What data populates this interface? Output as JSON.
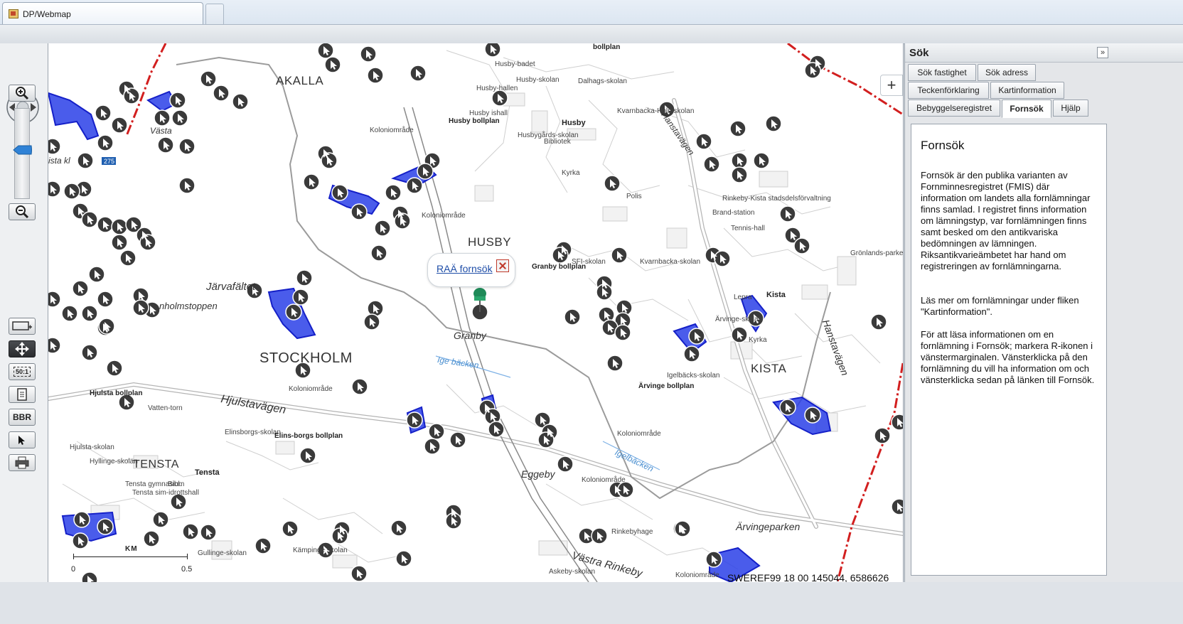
{
  "browser": {
    "tab_title": "DP/Webmap"
  },
  "map": {
    "labels": {
      "akalla": "AKALLA",
      "stockholm": "STOCKHOLM",
      "husby": "HUSBY",
      "kista": "KISTA",
      "tensta": "TENSTA",
      "jarvafaltet": "Järvafältet",
      "granby": "Granby",
      "eggeby": "Eggeby",
      "arvingeparken": "Ärvingeparken",
      "hjulstavagen": "Hjulstavägen",
      "hanstavagen": "Hanstavägen",
      "vastra_rinkeby": "Västra Rinkeby",
      "igelbacken": "Igelbäcken",
      "ige_backen": "Ige bäcken",
      "kolonio1": "Koloniområde",
      "kolonio2": "Koloniområde",
      "kolonio3": "Koloniområde",
      "kolonio4": "Koloniområde",
      "kolonio5": "Koloniområde",
      "kolonio6": "Koloniområde",
      "husby_skolan": "Husby-skolan",
      "husby_badet": "Husby-badet",
      "husby_hallen": "Husby-hallen",
      "husby_ishall": "Husby ishall",
      "husby_bollplan": "Husby bollplan",
      "husby_center": "Husby",
      "husbygards_skolan": "Husbygårds-skolan",
      "bibliotek": "Bibliotek",
      "kyrka": "Kyrka",
      "dalhags_skolan": "Dalhags-skolan",
      "bollplan_top": "bollplan",
      "kvarnbacka_holmskolan": "Kvarnbacka-Holmskolan",
      "polis": "Polis",
      "sfi_skolan": "SFI-skolan",
      "kvarnbacka_skolan": "Kvarnbacka-skolan",
      "granby_bollplan": "Granby bollplan",
      "rinkeby_kista": "Rinkeby-Kista stadsdelsförvaltning",
      "brandstation": "Brand-station",
      "tennishall": "Tennis-hall",
      "gronlandsparken": "Grönlands-parken",
      "kista_small": "Kista",
      "lepra": "Lepra",
      "arvinge_skolan": "Ärvinge-skolan",
      "kyrka2": "Kyrka",
      "igelbacks_skolan": "Igelbäcks-skolan",
      "arvinge_bollplan": "Ärvinge bollplan",
      "rinkebyhage": "Rinkebyhage",
      "hjulsta_bollplan": "Hjulsta bollplan",
      "vatten_torn": "Vatten-torn",
      "elinsborgs_skolan": "Elinsborgs-skolan",
      "elins_borgs_bollplan": "Elins-borgs bollplan",
      "hjulsta_skolan": "Hjulsta-skolan",
      "hyllinge_skolan": "Hyllinge-skolan",
      "tensta_small": "Tensta",
      "tensta_gymnasium": "Tensta gymnasium",
      "bibl": "Bibl.",
      "tensta_sim": "Tensta sim-idrottshall",
      "gullinge_skolan": "Gullinge-skolan",
      "askeby_skolan": "Askeby-skolan",
      "kampinge_skolan": "Kämpinge skolan",
      "nolmstoppen": "nholmstoppen",
      "vasta": "Västa",
      "ista_kl": "ista kl",
      "road_275": "275"
    },
    "popup": {
      "link_text": "RAÄ fornsök"
    },
    "coordinate_readout": "SWEREF99 18 00 145044, 6586626",
    "scale": {
      "unit": "KM",
      "min": "0",
      "max": "0.5"
    },
    "zoom_button": "+"
  },
  "tools": {
    "zoom_in": "zoom-in",
    "zoom_out": "zoom-out",
    "scale_label": "50:1",
    "bbr_label": "BBR"
  },
  "side_panel": {
    "title": "Sök",
    "collapse_symbol": "»",
    "tabs": [
      {
        "label": "Sök fastighet"
      },
      {
        "label": "Sök adress"
      },
      {
        "label": "Teckenförklaring"
      },
      {
        "label": "Kartinformation"
      },
      {
        "label": "Bebyggelseregistret"
      },
      {
        "label": "Fornsök"
      },
      {
        "label": "Hjälp"
      }
    ],
    "active_tab": "Fornsök",
    "content": {
      "heading": "Fornsök",
      "paragraph1": "Fornsök är den publika varianten av Fornminnesregistret (FMIS) där information om landets alla fornlämningar finns samlad. I registret finns information om lämningstyp, var fornlämningen finns samt besked om den antikvariska bedömningen av lämningen. Riksantikvarieämbetet har hand om registreringen av fornlämningarna.",
      "paragraph2": "Läs mer om fornlämningar under fliken \"Kartinformation\".",
      "paragraph3": "För att läsa informationen om en fornlämning i Fornsök; markera R-ikonen i vänstermarginalen. Vänsterklicka på den fornlämning du vill ha information om och vänsterklicka sedan på länken till Fornsök."
    }
  },
  "colors": {
    "fornlamning_area": "#1f2be0",
    "fornlamning_marker": "#3a3a3a",
    "municipal_border": "#d21f1f",
    "road": "#b4b4b4",
    "railway": "#8a8a8a"
  }
}
